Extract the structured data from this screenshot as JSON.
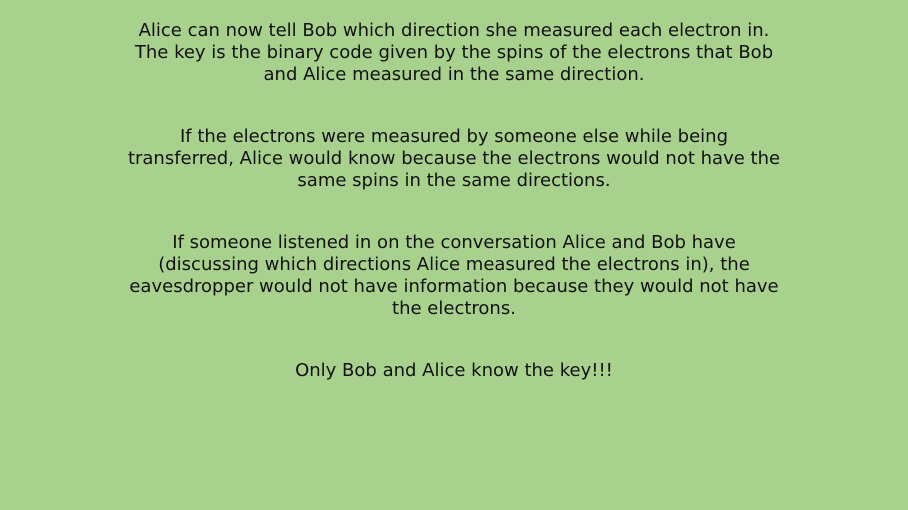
{
  "slide": {
    "background": "#a9d18e",
    "text_color": "#111111",
    "paragraphs": [
      "Alice can now tell Bob which direction she measured each electron in.\nThe key is the binary code given by the spins of the electrons that Bob\nand Alice measured in the same direction.",
      "If the electrons were measured by someone else while being\ntransferred, Alice would know because the electrons would not have the\nsame spins in the same directions.",
      "If someone listened in on the conversation Alice and Bob have\n(discussing which directions Alice measured the electrons in), the\neavesdropper would not have information because they would not have\nthe electrons.",
      "Only Bob and Alice know the key!!!"
    ]
  }
}
